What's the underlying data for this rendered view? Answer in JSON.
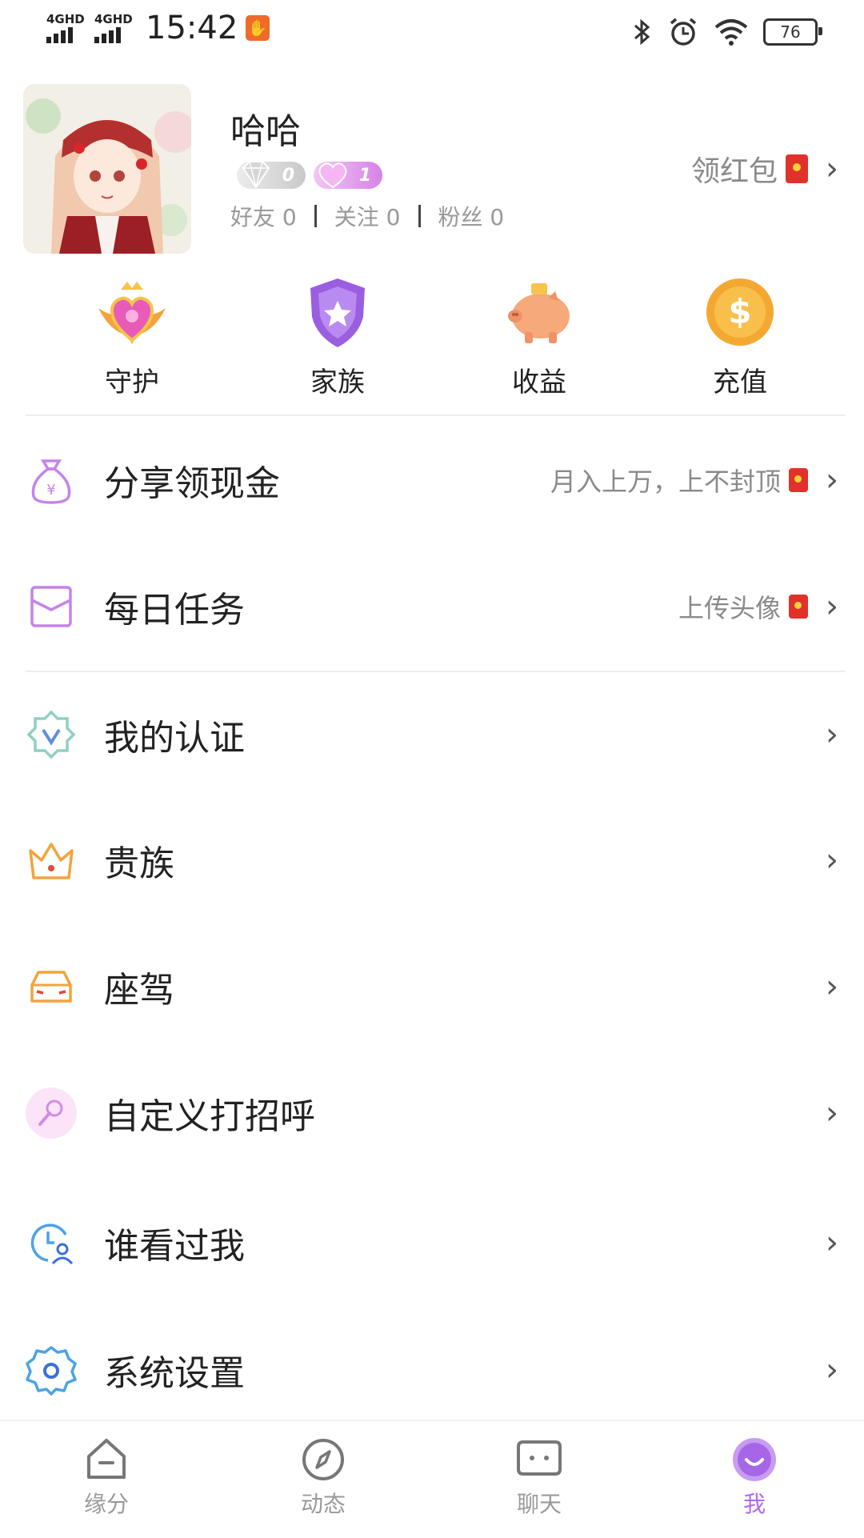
{
  "status_bar": {
    "signal1": "4GHD",
    "signal2": "4GHD",
    "time": "15:42",
    "battery": "76"
  },
  "profile": {
    "nickname": "哈哈",
    "diamond_level": "0",
    "heart_level": "1",
    "friends_label": "好友",
    "friends_count": "0",
    "following_label": "关注",
    "following_count": "0",
    "fans_label": "粉丝",
    "fans_count": "0",
    "redpack_label": "领红包"
  },
  "shortcuts": [
    {
      "label": "守护",
      "icon": "guard-crown-heart-icon"
    },
    {
      "label": "家族",
      "icon": "family-shield-icon"
    },
    {
      "label": "收益",
      "icon": "piggy-bank-icon"
    },
    {
      "label": "充值",
      "icon": "dollar-coin-icon"
    }
  ],
  "menu": [
    {
      "label": "分享领现金",
      "hint": "月入上万，上不封顶",
      "icon": "money-bag-icon"
    },
    {
      "label": "每日任务",
      "hint": "上传头像",
      "icon": "envelope-icon"
    },
    {
      "label": "我的认证",
      "hint": "",
      "icon": "verified-badge-icon"
    },
    {
      "label": "贵族",
      "hint": "",
      "icon": "crown-icon"
    },
    {
      "label": "座驾",
      "hint": "",
      "icon": "car-icon"
    },
    {
      "label": "自定义打招呼",
      "hint": "",
      "icon": "microphone-icon"
    },
    {
      "label": "谁看过我",
      "hint": "",
      "icon": "visitor-clock-icon"
    },
    {
      "label": "系统设置",
      "hint": "",
      "icon": "settings-gear-icon"
    }
  ],
  "bottom_nav": [
    {
      "label": "缘分",
      "icon": "home-icon",
      "active": false
    },
    {
      "label": "动态",
      "icon": "compass-icon",
      "active": false
    },
    {
      "label": "聊天",
      "icon": "chat-icon",
      "active": false
    },
    {
      "label": "我",
      "icon": "profile-icon",
      "active": true
    }
  ],
  "colors": {
    "accent": "#b06be8",
    "red_envelope": "#e0322a",
    "text_secondary": "#8a8a8a"
  }
}
